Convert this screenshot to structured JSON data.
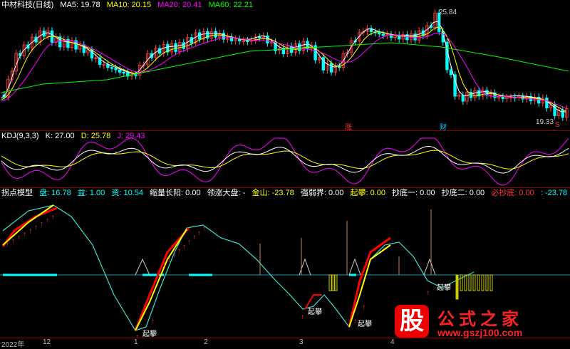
{
  "main": {
    "title": "中材科技(日线)",
    "ma": [
      {
        "label": "MA5: 19.78",
        "color": "#ffffff"
      },
      {
        "label": "MA10: 20.15",
        "color": "#ffff00"
      },
      {
        "label": "MA20: 20.41",
        "color": "#ff00ff"
      },
      {
        "label": "MA60: 22.21",
        "color": "#00ff00"
      }
    ],
    "high_label": "25.84",
    "low_label": "19.33",
    "markers": [
      "涨",
      "财",
      "S"
    ]
  },
  "kdj": {
    "title": "KDJ(9,3,3)",
    "k": "K: 27.00",
    "d": "D: 25.78",
    "j": "J: 29.43"
  },
  "indicator": {
    "title": "拐点模型",
    "fields": [
      {
        "label": "盘: 16.78",
        "color": "#00ffff"
      },
      {
        "label": "益: 1.00",
        "color": "#00ffff"
      },
      {
        "label": "资: 10.54",
        "color": "#00ffff"
      },
      {
        "label": "缩量长阳: 0.00",
        "color": "#ffffff"
      },
      {
        "label": "领涨大盘: -",
        "color": "#ffffff"
      },
      {
        "label": "金山: -23.78",
        "color": "#ffff00"
      },
      {
        "label": "强弱界: 0.00",
        "color": "#ffffff"
      },
      {
        "label": "起攀: 0.00",
        "color": "#ffff00"
      },
      {
        "label": "抄底一: 0.00",
        "color": "#ffffff"
      },
      {
        "label": "抄底二: 0.00",
        "color": "#ffffff"
      },
      {
        "label": "必抄底: 0.00",
        "color": "#ff3333"
      },
      {
        "label": ": -23.78",
        "color": "#00ffff"
      }
    ],
    "signal_label": "起攀"
  },
  "axis": {
    "labels": [
      "2022年",
      "12",
      "1",
      "2",
      "3",
      "4"
    ]
  },
  "watermark": {
    "logo": "股",
    "title": "公式之家",
    "url": "www.gszj100.com"
  }
}
